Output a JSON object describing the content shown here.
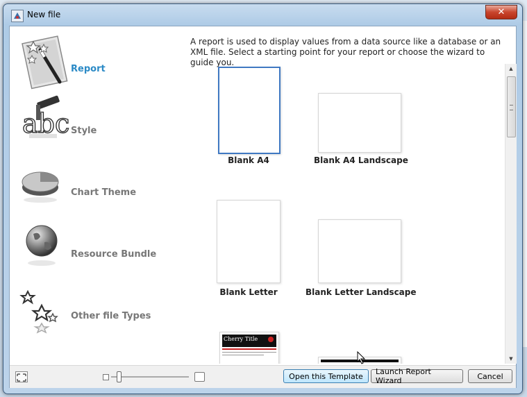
{
  "window": {
    "title": "New file",
    "close_glyph": "✕"
  },
  "description": "A report is used to display values from a data source like a database or an XML file. Select a starting point for your report or choose the wizard to guide you.",
  "file_types": [
    {
      "label": "Report",
      "icon": "report-icon",
      "selected": true
    },
    {
      "label": "Style",
      "icon": "style-icon",
      "selected": false
    },
    {
      "label": "Chart Theme",
      "icon": "chart-theme-icon",
      "selected": false
    },
    {
      "label": "Resource Bundle",
      "icon": "resource-bundle-icon",
      "selected": false
    },
    {
      "label": "Other file Types",
      "icon": "other-file-types-icon",
      "selected": false
    }
  ],
  "templates": [
    {
      "label": "Blank A4",
      "selected": true
    },
    {
      "label": "Blank A4 Landscape",
      "selected": false
    },
    {
      "label": "Blank Letter",
      "selected": false
    },
    {
      "label": "Blank Letter Landscape",
      "selected": false
    },
    {
      "label": "Cherry Title",
      "selected": false
    },
    {
      "label": "",
      "selected": false
    }
  ],
  "buttons": {
    "open_template": "Open this Template",
    "launch_wizard": "Launch Report Wizard",
    "cancel": "Cancel"
  },
  "colors": {
    "selected_accent": "#2b8ac6",
    "selection_border": "#3f78c2"
  }
}
